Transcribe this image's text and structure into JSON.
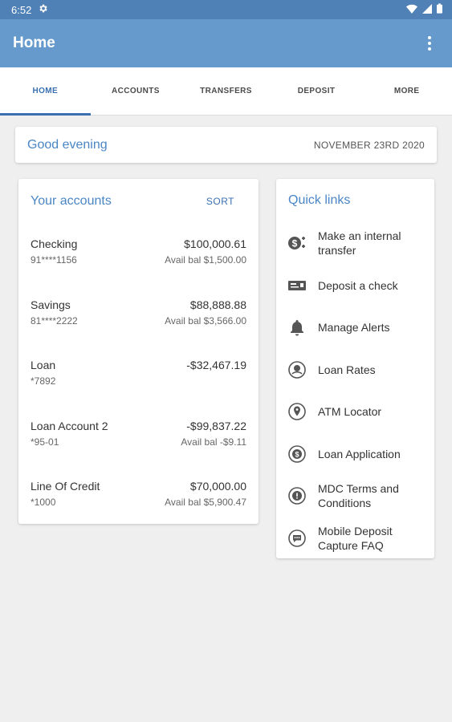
{
  "status_bar": {
    "time": "6:52"
  },
  "app_bar": {
    "title": "Home"
  },
  "tabs": [
    {
      "label": "HOME",
      "active": true
    },
    {
      "label": "ACCOUNTS",
      "active": false
    },
    {
      "label": "TRANSFERS",
      "active": false
    },
    {
      "label": "DEPOSIT",
      "active": false
    },
    {
      "label": "MORE",
      "active": false
    }
  ],
  "greeting": {
    "text": "Good evening",
    "date": "NOVEMBER 23RD 2020"
  },
  "accounts": {
    "title": "Your accounts",
    "sort_label": "SORT",
    "items": [
      {
        "name": "Checking",
        "number": "91****1156",
        "balance": "$100,000.61",
        "avail": "Avail bal $1,500.00"
      },
      {
        "name": "Savings",
        "number": "81****2222",
        "balance": "$88,888.88",
        "avail": "Avail bal $3,566.00"
      },
      {
        "name": "Loan",
        "number": "*7892",
        "balance": "-$32,467.19",
        "avail": ""
      },
      {
        "name": "Loan Account 2",
        "number": "*95-01",
        "balance": "-$99,837.22",
        "avail": "Avail bal -$9.11"
      },
      {
        "name": "Line Of Credit",
        "number": "*1000",
        "balance": "$70,000.00",
        "avail": "Avail bal $5,900.47"
      }
    ]
  },
  "quick_links": {
    "title": "Quick links",
    "items": [
      {
        "label": "Make an internal transfer",
        "icon": "transfer-dollar-icon"
      },
      {
        "label": "Deposit a check",
        "icon": "check-deposit-icon"
      },
      {
        "label": "Manage Alerts",
        "icon": "bell-icon"
      },
      {
        "label": "Loan Rates",
        "icon": "loan-rates-icon"
      },
      {
        "label": "ATM Locator",
        "icon": "location-pin-icon"
      },
      {
        "label": "Loan Application",
        "icon": "dollar-circle-icon"
      },
      {
        "label": "MDC Terms and Conditions",
        "icon": "info-circle-icon"
      },
      {
        "label": "Mobile Deposit Capture FAQ",
        "icon": "chat-bubble-icon"
      }
    ]
  },
  "colors": {
    "status_bar": "#4f81b7",
    "app_bar": "#6699cc",
    "accent": "#3a70b0",
    "title_blue": "#4a86c5",
    "background": "#efefef"
  }
}
